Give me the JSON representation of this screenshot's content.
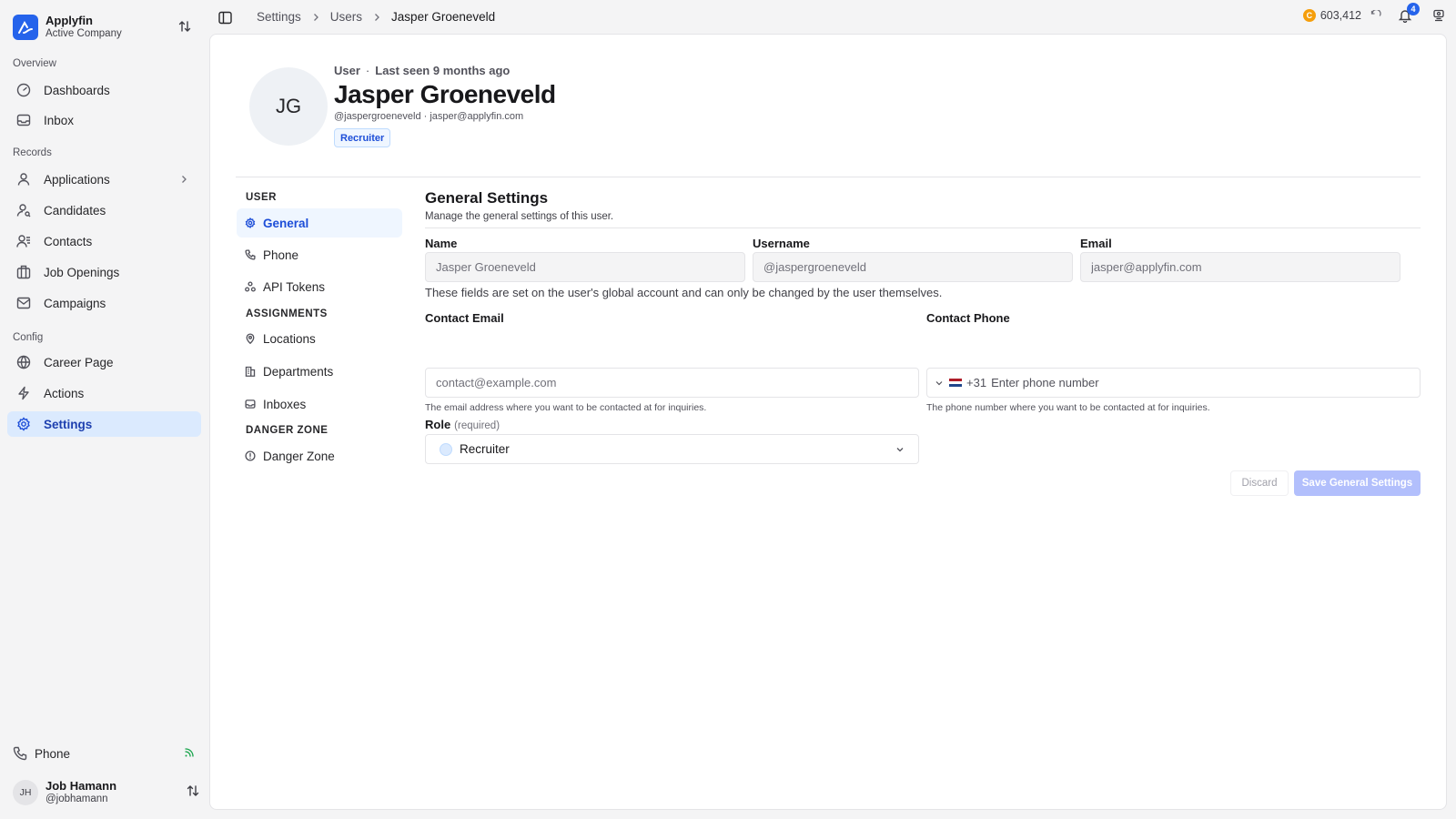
{
  "company": {
    "name": "Applyfin",
    "subtitle": "Active Company"
  },
  "sidebar": {
    "sections": {
      "overview": "Overview",
      "records": "Records",
      "config": "Config"
    },
    "items": [
      {
        "label": "Dashboards",
        "icon": "gauge-icon"
      },
      {
        "label": "Inbox",
        "icon": "inbox-icon"
      },
      {
        "label": "Applications",
        "icon": "user-icon"
      },
      {
        "label": "Candidates",
        "icon": "user-search-icon"
      },
      {
        "label": "Contacts",
        "icon": "contacts-icon"
      },
      {
        "label": "Job Openings",
        "icon": "building-icon"
      },
      {
        "label": "Campaigns",
        "icon": "mail-open-icon"
      },
      {
        "label": "Career Page",
        "icon": "globe-icon"
      },
      {
        "label": "Actions",
        "icon": "zap-icon"
      },
      {
        "label": "Settings",
        "icon": "gear-icon"
      }
    ],
    "phone_label": "Phone",
    "user": {
      "initials": "JH",
      "name": "Job Hamann",
      "handle": "@jobhamann"
    }
  },
  "breadcrumb": {
    "items": [
      "Settings",
      "Users",
      "Jasper Groeneveld"
    ]
  },
  "topbar": {
    "credits": "603,412",
    "coin_symbol": "C",
    "notifications": "4"
  },
  "profile": {
    "initials": "JG",
    "type": "User",
    "last_seen": "Last seen 9 months ago",
    "name": "Jasper Groeneveld",
    "handle_email": "@jaspergroeneveld · jasper@applyfin.com",
    "role_badge": "Recruiter"
  },
  "subnav": {
    "user_label": "USER",
    "assignments_label": "ASSIGNMENTS",
    "danger_label": "DANGER ZONE",
    "items": [
      "General",
      "Phone",
      "API Tokens",
      "Locations",
      "Departments",
      "Inboxes",
      "Danger Zone"
    ]
  },
  "form": {
    "title": "General Settings",
    "description": "Manage the general settings of this user.",
    "name_label": "Name",
    "name_value": "Jasper Groeneveld",
    "username_label": "Username",
    "username_value": "@jaspergroeneveld",
    "email_label": "Email",
    "email_value": "jasper@applyfin.com",
    "global_note": "These fields are set on the user's global account and can only be changed by the user themselves.",
    "contact_email_label": "Contact Email",
    "contact_email_placeholder": "contact@example.com",
    "contact_email_help": "The email address where you want to be contacted at for inquiries.",
    "contact_phone_label": "Contact Phone",
    "phone_code": "+31",
    "phone_placeholder": "Enter phone number",
    "contact_phone_help": "The phone number where you want to be contacted at for inquiries.",
    "role_label": "Role",
    "role_required": "(required)",
    "role_value": "Recruiter",
    "discard_label": "Discard",
    "save_label": "Save General Settings"
  },
  "colors": {
    "accent": "#2563eb",
    "active_bg": "#dbeafe",
    "badge_bg": "#eff6ff",
    "save_disabled": "#a5b4fc"
  }
}
